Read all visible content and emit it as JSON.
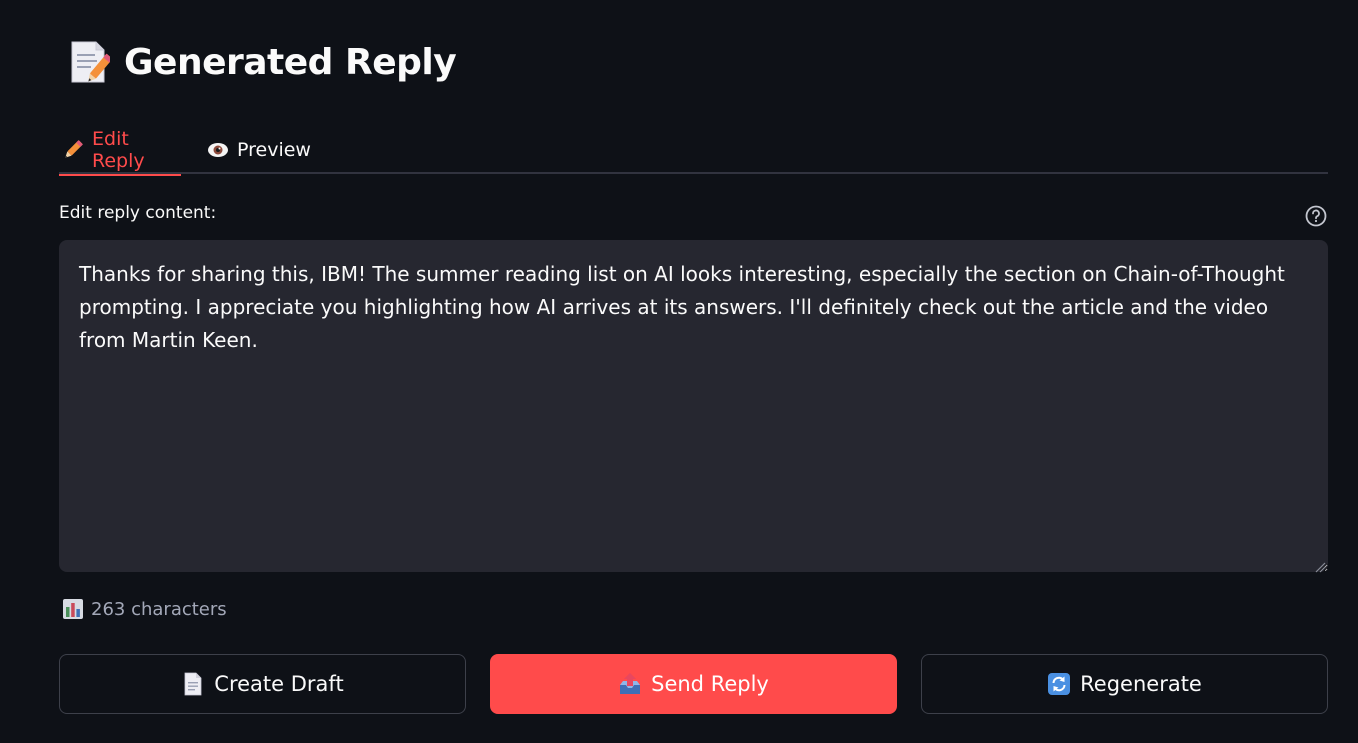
{
  "header": {
    "icon": "memo-icon",
    "title": "Generated Reply"
  },
  "tabs": [
    {
      "label": "Edit Reply",
      "icon": "pencil-icon",
      "active": true
    },
    {
      "label": "Preview",
      "icon": "eye-icon",
      "active": false
    }
  ],
  "editor": {
    "label": "Edit reply content:",
    "help_icon": "question-circle-icon",
    "content": "Thanks for sharing this, IBM! The summer reading list on AI looks interesting, especially the section on Chain-of-Thought prompting. I appreciate you highlighting how AI arrives at its answers. I'll definitely check out the article and the video from Martin Keen."
  },
  "stats": {
    "icon": "bar-chart-icon",
    "char_count_text": "263 characters"
  },
  "actions": {
    "create_draft": {
      "label": "Create Draft",
      "icon": "page-icon"
    },
    "send_reply": {
      "label": "Send Reply",
      "icon": "outbox-tray-icon"
    },
    "regenerate": {
      "label": "Regenerate",
      "icon": "refresh-arrows-icon"
    }
  },
  "colors": {
    "background": "#0e1117",
    "accent": "#ff4b4b",
    "input_bg": "#262730",
    "muted_text": "#a3a8b8"
  }
}
